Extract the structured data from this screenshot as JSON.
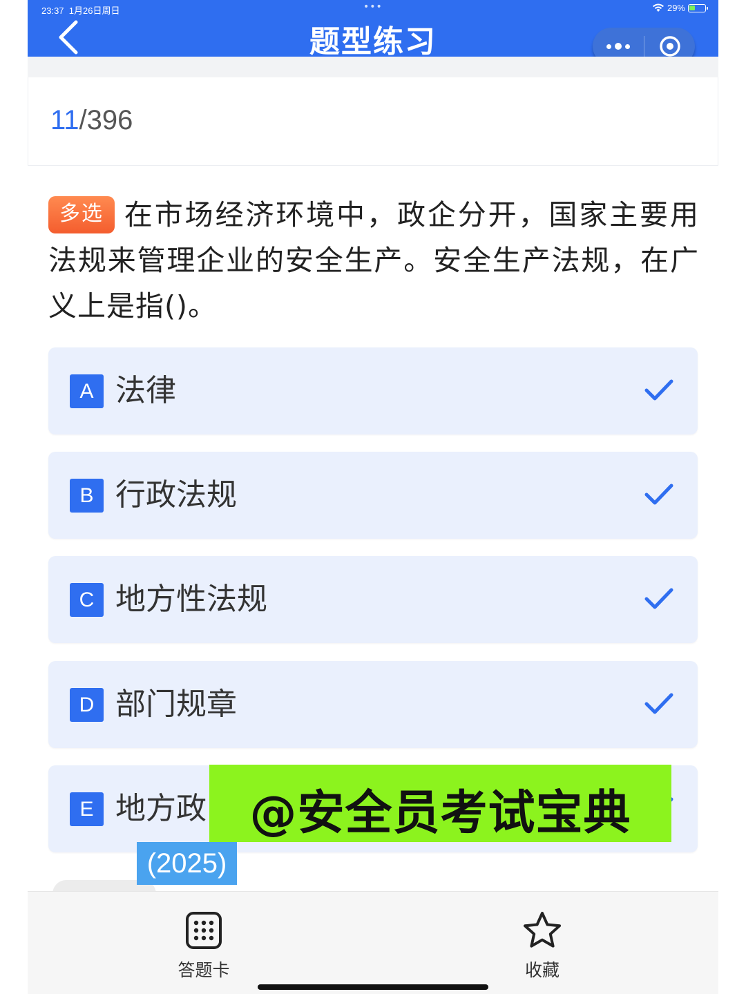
{
  "status_bar": {
    "time": "23:37",
    "date": "1月26日周日",
    "battery": "29%"
  },
  "header": {
    "title": "题型练习"
  },
  "progress": {
    "current": "11",
    "separator": "/",
    "total": "396"
  },
  "question": {
    "type_badge": "多选",
    "text": "在市场经济环境中，政企分开，国家主要用法规来管理企业的安全生产。安全生产法规，在广义上是指()。"
  },
  "options": [
    {
      "letter": "A",
      "text": "法律"
    },
    {
      "letter": "B",
      "text": "行政法规"
    },
    {
      "letter": "C",
      "text": "地方性法规"
    },
    {
      "letter": "D",
      "text": "部门规章"
    },
    {
      "letter": "E",
      "text": "地方政"
    }
  ],
  "watermarks": {
    "main": "@安全员考试宝典",
    "year": "(2025)"
  },
  "bottom_bar": {
    "answer_card_label": "答题卡",
    "favorite_label": "收藏"
  },
  "colors": {
    "primary": "#2f6ef0",
    "option_bg": "#eaf0fd",
    "badge": "#f45d2e",
    "watermark_green": "#8cf31e",
    "watermark_blue": "#4aa3ef"
  },
  "icons": [
    "back-arrow-icon",
    "more-dots-icon",
    "target-icon",
    "check-icon",
    "grid-card-icon",
    "star-icon"
  ]
}
